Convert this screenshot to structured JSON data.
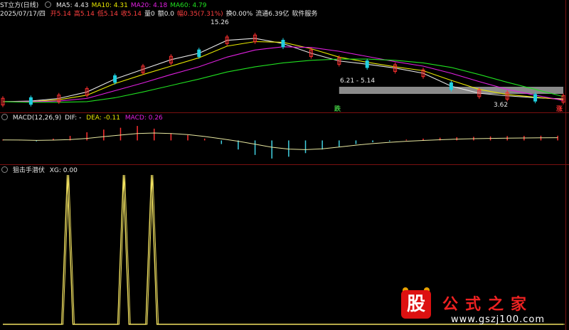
{
  "header": {
    "title": "ST立方(日线)",
    "ma_labels": [
      {
        "text": "MA5: 4.43",
        "color": "#e8e8e8"
      },
      {
        "text": "MA10: 4.31",
        "color": "#e8e800"
      },
      {
        "text": "MA20: 4.18",
        "color": "#e020e0"
      },
      {
        "text": "MA60: 4.79",
        "color": "#20e020"
      }
    ],
    "date": "2025/07/17/四",
    "quote_items": [
      {
        "text": "开5.14",
        "color": "#ff4040"
      },
      {
        "text": "高5.14",
        "color": "#ff4040"
      },
      {
        "text": "低5.14",
        "color": "#ff4040"
      },
      {
        "text": "收5.14",
        "color": "#ff4040"
      },
      {
        "text": "量0",
        "color": "#e8e8e8"
      },
      {
        "text": "额0.0",
        "color": "#e8e8e8"
      },
      {
        "text": "幅0.35(7.31%)",
        "color": "#ff4040"
      },
      {
        "text": "换0.00%",
        "color": "#e8e8e8"
      },
      {
        "text": "流通6.39亿",
        "color": "#e8e8e8"
      },
      {
        "text": "软件服务",
        "color": "#e8e8e8"
      }
    ]
  },
  "macd_header": {
    "name": "MACD(12,26,9)",
    "dif": "DIF: -",
    "dea": "DEA: -0.11",
    "macd": "MACD: 0.26",
    "dif_color": "#e8e8e8",
    "dea_color": "#e8e800",
    "macd_color": "#e020e0"
  },
  "xg_header": {
    "name": "狙击手潜伏",
    "value": "XG: 0.00"
  },
  "annotations": {
    "high": "15.26",
    "mid": "6.21 - 5.14",
    "low": "3.62",
    "left_tag": "跌",
    "right_tag": "涨"
  },
  "watermark": {
    "logo_char": "股",
    "site_name": "公式之家",
    "site_url": "www.gszj100.com"
  },
  "chart_data": [
    {
      "type": "line",
      "name": "price_ma",
      "series": [
        {
          "name": "MA5",
          "color": "#e8e8e8",
          "x": [
            0,
            5,
            10,
            15,
            20,
            25,
            30,
            35,
            40,
            45,
            50,
            55,
            60,
            65,
            70,
            75,
            80,
            85,
            90,
            95,
            100
          ],
          "values": [
            4.0,
            4.1,
            4.5,
            5.5,
            7.5,
            9.0,
            10.5,
            11.5,
            13.5,
            13.8,
            13.0,
            11.5,
            10.3,
            9.8,
            9.2,
            8.4,
            6.4,
            5.3,
            4.9,
            4.6,
            4.43
          ]
        },
        {
          "name": "MA10",
          "color": "#e8e800",
          "x": [
            0,
            5,
            10,
            15,
            20,
            25,
            30,
            35,
            40,
            45,
            50,
            55,
            60,
            65,
            70,
            75,
            80,
            85,
            90,
            95,
            100
          ],
          "values": [
            4.0,
            4.0,
            4.3,
            5.0,
            6.8,
            8.2,
            9.5,
            10.8,
            12.6,
            13.3,
            13.2,
            12.2,
            10.9,
            10.1,
            9.4,
            8.8,
            7.3,
            5.9,
            5.1,
            4.7,
            4.31
          ]
        },
        {
          "name": "MA20",
          "color": "#e020e0",
          "x": [
            0,
            5,
            10,
            15,
            20,
            25,
            30,
            35,
            40,
            45,
            50,
            55,
            60,
            65,
            70,
            75,
            80,
            85,
            90,
            95,
            100
          ],
          "values": [
            4.0,
            4.0,
            4.1,
            4.5,
            5.7,
            6.9,
            8.2,
            9.4,
            10.9,
            12.0,
            12.5,
            12.4,
            11.8,
            11.0,
            10.2,
            9.5,
            8.4,
            7.1,
            5.9,
            5.0,
            4.18
          ]
        },
        {
          "name": "MA60",
          "color": "#20e020",
          "x": [
            0,
            5,
            10,
            15,
            20,
            25,
            30,
            35,
            40,
            45,
            50,
            55,
            60,
            65,
            70,
            75,
            80,
            85,
            90,
            95,
            100
          ],
          "values": [
            4.0,
            3.9,
            3.9,
            4.0,
            4.6,
            5.5,
            6.5,
            7.5,
            8.6,
            9.4,
            10.0,
            10.4,
            10.6,
            10.6,
            10.4,
            10.0,
            9.3,
            8.2,
            7.0,
            5.9,
            4.79
          ]
        }
      ],
      "ylim": [
        3,
        16
      ]
    },
    {
      "type": "bar",
      "name": "macd",
      "x": [
        0,
        3,
        6,
        9,
        12,
        15,
        18,
        21,
        24,
        27,
        30,
        33,
        36,
        39,
        42,
        45,
        48,
        51,
        54,
        57,
        60,
        63,
        66,
        69,
        72,
        75,
        78,
        81,
        84,
        87,
        90,
        93,
        96,
        99
      ],
      "values": [
        0.05,
        0.02,
        -0.05,
        0.1,
        0.25,
        0.45,
        0.6,
        0.7,
        0.8,
        0.65,
        0.4,
        0.3,
        0.1,
        -0.2,
        -0.5,
        -0.8,
        -1.0,
        -0.9,
        -0.7,
        -0.5,
        -0.35,
        -0.2,
        -0.1,
        -0.05,
        0.05,
        0.1,
        0.15,
        0.18,
        0.2,
        0.22,
        0.24,
        0.25,
        0.26,
        0.26
      ],
      "ylim": [
        -1.2,
        1.0
      ]
    },
    {
      "type": "line",
      "name": "xg",
      "x": [
        0,
        10.5,
        11.5,
        12.5,
        20.5,
        21.5,
        22.5,
        25.5,
        26.5,
        27.5,
        100
      ],
      "values": [
        0,
        0,
        1,
        0,
        0,
        1,
        0,
        0,
        1,
        0,
        0
      ],
      "ylim": [
        0,
        1
      ]
    }
  ]
}
